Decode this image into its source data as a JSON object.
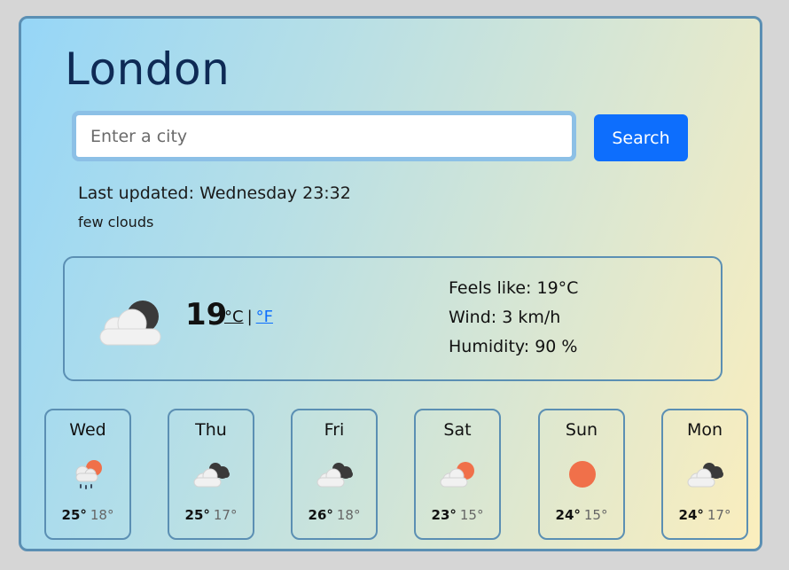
{
  "city": "London",
  "search": {
    "placeholder": "Enter a city",
    "button_label": "Search"
  },
  "updated": "Last updated: Wednesday 23:32",
  "description": "few clouds",
  "current": {
    "icon": "few-clouds-night-icon",
    "temperature": "19",
    "unit_celsius": "°C",
    "unit_separator": "|",
    "unit_fahrenheit": "°F",
    "feels_like": "Feels like: 19°C",
    "wind": "Wind: 3 km/h",
    "humidity": "Humidity: 90 %"
  },
  "forecast": [
    {
      "day": "Wed",
      "icon": "rain-sun-icon",
      "max": "25°",
      "min": "18°"
    },
    {
      "day": "Thu",
      "icon": "cloudy-night-icon",
      "max": "25°",
      "min": "17°"
    },
    {
      "day": "Fri",
      "icon": "cloudy-night-icon",
      "max": "26°",
      "min": "18°"
    },
    {
      "day": "Sat",
      "icon": "partly-cloudy-icon",
      "max": "23°",
      "min": "15°"
    },
    {
      "day": "Sun",
      "icon": "sun-icon",
      "max": "24°",
      "min": "15°"
    },
    {
      "day": "Mon",
      "icon": "cloudy-night-icon",
      "max": "24°",
      "min": "17°"
    }
  ],
  "colors": {
    "accent": "#0d6efd",
    "card_border": "#5b8fb3",
    "sun": "#f0704a",
    "title": "#0e2a55"
  }
}
